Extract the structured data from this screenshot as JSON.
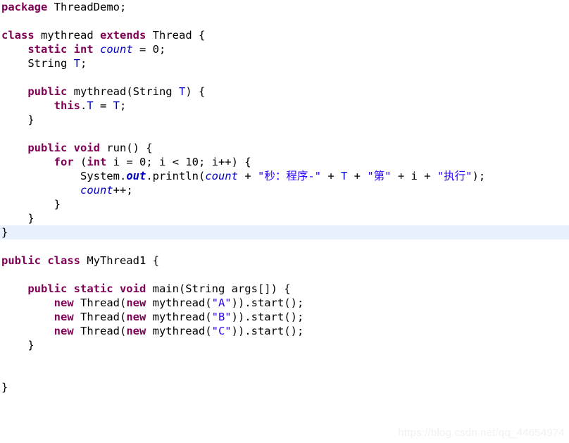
{
  "editor": {
    "language": "java",
    "font_size_px": 15.5,
    "line_height_px": 20,
    "background_color": "#ffffff",
    "highlighted_line_background": "#e8f0fd",
    "highlighted_line_number": 20,
    "theme_colors": {
      "keyword": "#7f0055",
      "string": "#2a00ff",
      "field": "#0000c0",
      "static_field": "#0000c0",
      "plain_text": "#000000"
    }
  },
  "lines": [
    {
      "n": 1,
      "highlight": false,
      "tokens": [
        {
          "t": "kw",
          "v": "package"
        },
        {
          "t": "pl",
          "v": " ThreadDemo;"
        }
      ]
    },
    {
      "n": 2,
      "highlight": false,
      "tokens": [
        {
          "t": "pl",
          "v": ""
        }
      ]
    },
    {
      "n": 3,
      "highlight": false,
      "tokens": [
        {
          "t": "kw",
          "v": "class"
        },
        {
          "t": "pl",
          "v": " mythread "
        },
        {
          "t": "kw",
          "v": "extends"
        },
        {
          "t": "pl",
          "v": " Thread {"
        }
      ]
    },
    {
      "n": 4,
      "highlight": false,
      "tokens": [
        {
          "t": "pl",
          "v": "    "
        },
        {
          "t": "kw",
          "v": "static int"
        },
        {
          "t": "pl",
          "v": " "
        },
        {
          "t": "sfld",
          "v": "count"
        },
        {
          "t": "pl",
          "v": " = 0;"
        }
      ]
    },
    {
      "n": 5,
      "highlight": false,
      "tokens": [
        {
          "t": "pl",
          "v": "    String "
        },
        {
          "t": "fld",
          "v": "T"
        },
        {
          "t": "pl",
          "v": ";"
        }
      ]
    },
    {
      "n": 6,
      "highlight": false,
      "tokens": [
        {
          "t": "pl",
          "v": ""
        }
      ]
    },
    {
      "n": 7,
      "highlight": false,
      "tokens": [
        {
          "t": "pl",
          "v": "    "
        },
        {
          "t": "kw",
          "v": "public"
        },
        {
          "t": "pl",
          "v": " mythread(String "
        },
        {
          "t": "fld",
          "v": "T"
        },
        {
          "t": "pl",
          "v": ") {"
        }
      ]
    },
    {
      "n": 8,
      "highlight": false,
      "tokens": [
        {
          "t": "pl",
          "v": "        "
        },
        {
          "t": "kw",
          "v": "this"
        },
        {
          "t": "pl",
          "v": "."
        },
        {
          "t": "fld",
          "v": "T"
        },
        {
          "t": "pl",
          "v": " = "
        },
        {
          "t": "fld",
          "v": "T"
        },
        {
          "t": "pl",
          "v": ";"
        }
      ]
    },
    {
      "n": 9,
      "highlight": false,
      "tokens": [
        {
          "t": "pl",
          "v": "    }"
        }
      ]
    },
    {
      "n": 10,
      "highlight": false,
      "tokens": [
        {
          "t": "pl",
          "v": ""
        }
      ]
    },
    {
      "n": 11,
      "highlight": false,
      "tokens": [
        {
          "t": "pl",
          "v": "    "
        },
        {
          "t": "kw",
          "v": "public void"
        },
        {
          "t": "pl",
          "v": " run() {"
        }
      ]
    },
    {
      "n": 12,
      "highlight": false,
      "tokens": [
        {
          "t": "pl",
          "v": "        "
        },
        {
          "t": "kw",
          "v": "for"
        },
        {
          "t": "pl",
          "v": " ("
        },
        {
          "t": "kw",
          "v": "int"
        },
        {
          "t": "pl",
          "v": " i = 0; i < 10; i++) {"
        }
      ]
    },
    {
      "n": 13,
      "highlight": false,
      "tokens": [
        {
          "t": "pl",
          "v": "            System."
        },
        {
          "t": "sfldb",
          "v": "out"
        },
        {
          "t": "pl",
          "v": ".println("
        },
        {
          "t": "sfld",
          "v": "count"
        },
        {
          "t": "pl",
          "v": " + "
        },
        {
          "t": "str",
          "v": "\"秒：程序-\""
        },
        {
          "t": "pl",
          "v": " + "
        },
        {
          "t": "fld",
          "v": "T"
        },
        {
          "t": "pl",
          "v": " + "
        },
        {
          "t": "str",
          "v": "\"第\""
        },
        {
          "t": "pl",
          "v": " + i + "
        },
        {
          "t": "str",
          "v": "\"执行\""
        },
        {
          "t": "pl",
          "v": ");"
        }
      ]
    },
    {
      "n": 14,
      "highlight": false,
      "tokens": [
        {
          "t": "pl",
          "v": "            "
        },
        {
          "t": "sfld",
          "v": "count"
        },
        {
          "t": "pl",
          "v": "++;"
        }
      ]
    },
    {
      "n": 15,
      "highlight": false,
      "tokens": [
        {
          "t": "pl",
          "v": "        }"
        }
      ]
    },
    {
      "n": 16,
      "highlight": false,
      "tokens": [
        {
          "t": "pl",
          "v": "    }"
        }
      ]
    },
    {
      "n": 17,
      "highlight": true,
      "tokens": [
        {
          "t": "pl",
          "v": "}"
        }
      ]
    },
    {
      "n": 18,
      "highlight": false,
      "tokens": [
        {
          "t": "pl",
          "v": ""
        }
      ]
    },
    {
      "n": 19,
      "highlight": false,
      "tokens": [
        {
          "t": "kw",
          "v": "public class"
        },
        {
          "t": "pl",
          "v": " MyThread1 {"
        }
      ]
    },
    {
      "n": 20,
      "highlight": false,
      "tokens": [
        {
          "t": "pl",
          "v": ""
        }
      ]
    },
    {
      "n": 21,
      "highlight": false,
      "tokens": [
        {
          "t": "pl",
          "v": "    "
        },
        {
          "t": "kw",
          "v": "public static void"
        },
        {
          "t": "pl",
          "v": " main(String args[]) {"
        }
      ]
    },
    {
      "n": 22,
      "highlight": false,
      "tokens": [
        {
          "t": "pl",
          "v": "        "
        },
        {
          "t": "kw",
          "v": "new"
        },
        {
          "t": "pl",
          "v": " Thread("
        },
        {
          "t": "kw",
          "v": "new"
        },
        {
          "t": "pl",
          "v": " mythread("
        },
        {
          "t": "str",
          "v": "\"A\""
        },
        {
          "t": "pl",
          "v": ")).start();"
        }
      ]
    },
    {
      "n": 23,
      "highlight": false,
      "tokens": [
        {
          "t": "pl",
          "v": "        "
        },
        {
          "t": "kw",
          "v": "new"
        },
        {
          "t": "pl",
          "v": " Thread("
        },
        {
          "t": "kw",
          "v": "new"
        },
        {
          "t": "pl",
          "v": " mythread("
        },
        {
          "t": "str",
          "v": "\"B\""
        },
        {
          "t": "pl",
          "v": ")).start();"
        }
      ]
    },
    {
      "n": 24,
      "highlight": false,
      "tokens": [
        {
          "t": "pl",
          "v": "        "
        },
        {
          "t": "kw",
          "v": "new"
        },
        {
          "t": "pl",
          "v": " Thread("
        },
        {
          "t": "kw",
          "v": "new"
        },
        {
          "t": "pl",
          "v": " mythread("
        },
        {
          "t": "str",
          "v": "\"C\""
        },
        {
          "t": "pl",
          "v": ")).start();"
        }
      ]
    },
    {
      "n": 25,
      "highlight": false,
      "tokens": [
        {
          "t": "pl",
          "v": "    }"
        }
      ]
    },
    {
      "n": 26,
      "highlight": false,
      "tokens": [
        {
          "t": "pl",
          "v": ""
        }
      ]
    },
    {
      "n": 27,
      "highlight": false,
      "tokens": [
        {
          "t": "pl",
          "v": ""
        }
      ]
    },
    {
      "n": 28,
      "highlight": false,
      "tokens": [
        {
          "t": "pl",
          "v": "}"
        }
      ]
    }
  ],
  "watermark": {
    "text": "https://blog.csdn.net/qq_44654974",
    "color": "#f1f1f1"
  }
}
